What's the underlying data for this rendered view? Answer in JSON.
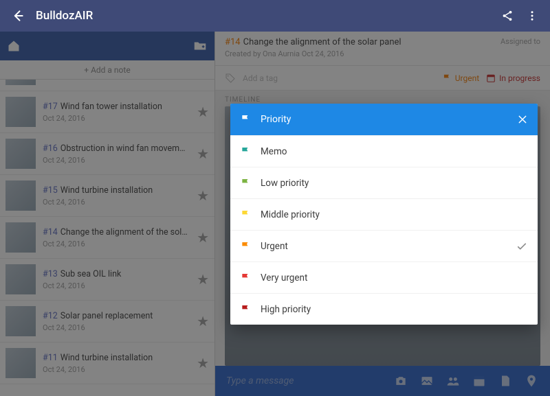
{
  "appbar": {
    "title": "BulldozAIR"
  },
  "left": {
    "add_note": "+ Add a note",
    "notes": [
      {
        "num": "#17",
        "title": "Wind fan tower installation",
        "date": "Oct 24, 2016"
      },
      {
        "num": "#16",
        "title": "Obstruction in wind fan movement",
        "date": "Oct 24, 2016"
      },
      {
        "num": "#15",
        "title": "Wind turbine installation",
        "date": "Oct 24, 2016"
      },
      {
        "num": "#14",
        "title": "Change the alignment of the solar pa...",
        "date": "Oct 24, 2016"
      },
      {
        "num": "#13",
        "title": "Sub sea OIL link",
        "date": "Oct 24, 2016"
      },
      {
        "num": "#12",
        "title": "Solar panel replacement",
        "date": "Oct 24, 2016"
      },
      {
        "num": "#11",
        "title": "Wind turbine installation",
        "date": "Oct 24, 2016"
      }
    ]
  },
  "detail": {
    "num": "#14",
    "title": "Change the alignment of the solar panel",
    "created": "Created by Ona Aurnia Oct 24, 2016",
    "assigned": "Assigned to",
    "addtag": "Add a tag",
    "urgent": "Urgent",
    "progress": "In progress",
    "timeline": "TIMELINE",
    "msg_placeholder": "Type a message"
  },
  "modal": {
    "title": "Priority",
    "options": [
      {
        "label": "Memo",
        "color": "#26a69a",
        "selected": false
      },
      {
        "label": "Low priority",
        "color": "#7cb342",
        "selected": false
      },
      {
        "label": "Middle priority",
        "color": "#fdd835",
        "selected": false
      },
      {
        "label": "Urgent",
        "color": "#fb8c00",
        "selected": true
      },
      {
        "label": "Very urgent",
        "color": "#e53935",
        "selected": false
      },
      {
        "label": "High priority",
        "color": "#b71c1c",
        "selected": false
      }
    ]
  }
}
